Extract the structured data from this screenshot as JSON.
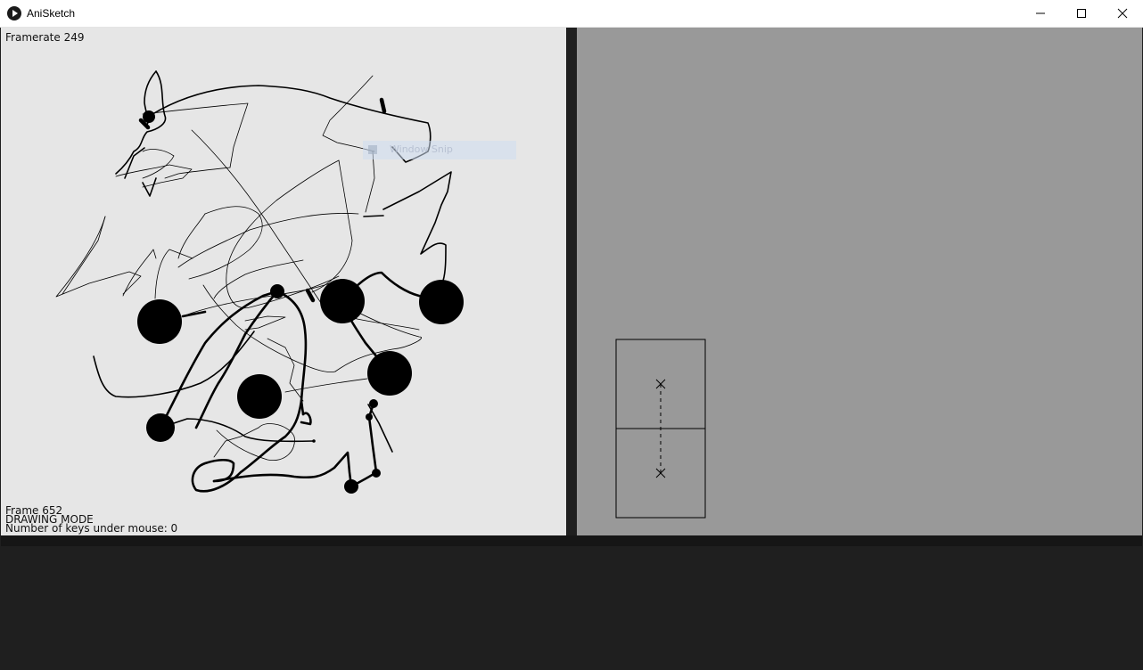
{
  "window": {
    "title": "AniSketch",
    "controls": {
      "minimize": "minimize-icon",
      "maximize": "maximize-icon",
      "close": "close-icon"
    }
  },
  "canvas_left": {
    "framerate_text": "Framerate 249",
    "frame_text": "Frame 652",
    "mode_text": "DRAWING MODE",
    "keys_text": "Number of keys under mouse: 0",
    "overlay_label": "Window Snip"
  },
  "colors": {
    "canvas_left_bg": "#e6e6e6",
    "canvas_right_bg": "#999999",
    "panel_bg": "#1f1f1f",
    "ink": "#000000"
  }
}
